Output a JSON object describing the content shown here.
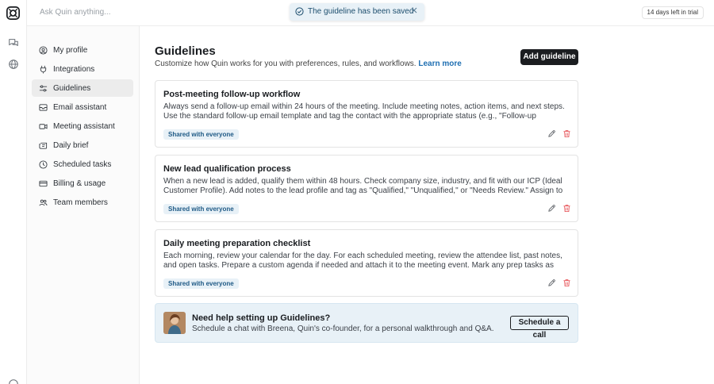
{
  "topbar": {
    "search_placeholder": "Ask Quin anything...",
    "trial_badge": "14 days left in trial"
  },
  "toast": {
    "message": "The guideline has been saved"
  },
  "settings_nav": {
    "items": [
      {
        "label": "My profile",
        "icon": "user-icon"
      },
      {
        "label": "Integrations",
        "icon": "plug-icon"
      },
      {
        "label": "Guidelines",
        "icon": "sliders-icon",
        "active": true
      },
      {
        "label": "Email assistant",
        "icon": "mail-icon"
      },
      {
        "label": "Meeting assistant",
        "icon": "video-icon"
      },
      {
        "label": "Daily brief",
        "icon": "newspaper-icon"
      },
      {
        "label": "Scheduled tasks",
        "icon": "clock-icon"
      },
      {
        "label": "Billing & usage",
        "icon": "credit-card-icon"
      },
      {
        "label": "Team members",
        "icon": "users-icon"
      }
    ]
  },
  "page": {
    "title": "Guidelines",
    "subtitle": "Customize how Quin works for you with preferences, rules, and workflows.",
    "learn_more": "Learn more",
    "add_button": "Add guideline"
  },
  "guidelines": [
    {
      "title": "Post-meeting follow-up workflow",
      "description": "Always send a follow-up email within 24 hours of the meeting. Include meeting notes, action items, and next steps. Use the standard follow-up email template and tag the contact with the appropriate status (e.g., \"Follow-up Needed\" or \"Closed\").",
      "badge": "Shared with everyone"
    },
    {
      "title": "New lead qualification process",
      "description": "When a new lead is added, qualify them within 48 hours. Check company size, industry, and fit with our ICP (Ideal Customer Profile). Add notes to the lead profile and tag as \"Qualified,\" \"Unqualified,\" or \"Needs Review.\" Assign to the appropriate sales rep ...",
      "badge": "Shared with everyone"
    },
    {
      "title": "Daily meeting preparation checklist",
      "description": "Each morning, review your calendar for the day. For each scheduled meeting, review the attendee list, past notes, and open tasks. Prepare a custom agenda if needed and attach it to the meeting event. Mark any prep tasks as complete in the system.",
      "badge": "Shared with everyone"
    }
  ],
  "help": {
    "title": "Need help setting up Guidelines?",
    "subtitle": "Schedule a chat with Breena, Quin's co-founder, for a personal walkthrough and Q&A.",
    "button": "Schedule a call"
  },
  "colors": {
    "accent": "#1f6fb2",
    "badge_bg": "#e8f1f7",
    "delete": "#e5484d",
    "primary_button": "#1b1d20"
  }
}
